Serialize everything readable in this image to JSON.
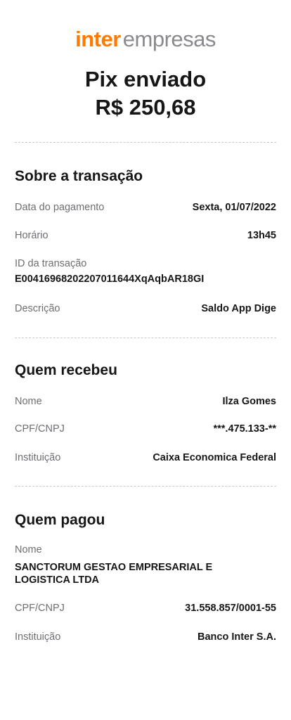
{
  "logo": {
    "brand": "inter",
    "sub": "empresas",
    "brand_color": "#ff7a00"
  },
  "header": {
    "title": "Pix enviado",
    "amount": "R$ 250,68"
  },
  "transaction": {
    "title": "Sobre a transação",
    "date_label": "Data do pagamento",
    "date_value": "Sexta, 01/07/2022",
    "time_label": "Horário",
    "time_value": "13h45",
    "id_label": "ID da transação",
    "id_value": "E00416968202207011644XqAqbAR18GI",
    "description_label": "Descrição",
    "description_value": "Saldo App Dige"
  },
  "recipient": {
    "title": "Quem recebeu",
    "name_label": "Nome",
    "name_value": "Ilza Gomes",
    "doc_label": "CPF/CNPJ",
    "doc_value": "***.475.133-**",
    "institution_label": "Instituição",
    "institution_value": "Caixa Economica Federal"
  },
  "payer": {
    "title": "Quem pagou",
    "name_label": "Nome",
    "name_line1": "SANCTORUM GESTAO EMPRESARIAL E",
    "name_line2": "LOGISTICA LTDA",
    "doc_label": "CPF/CNPJ",
    "doc_value": "31.558.857/0001-55",
    "institution_label": "Instituição",
    "institution_value": "Banco Inter S.A."
  }
}
